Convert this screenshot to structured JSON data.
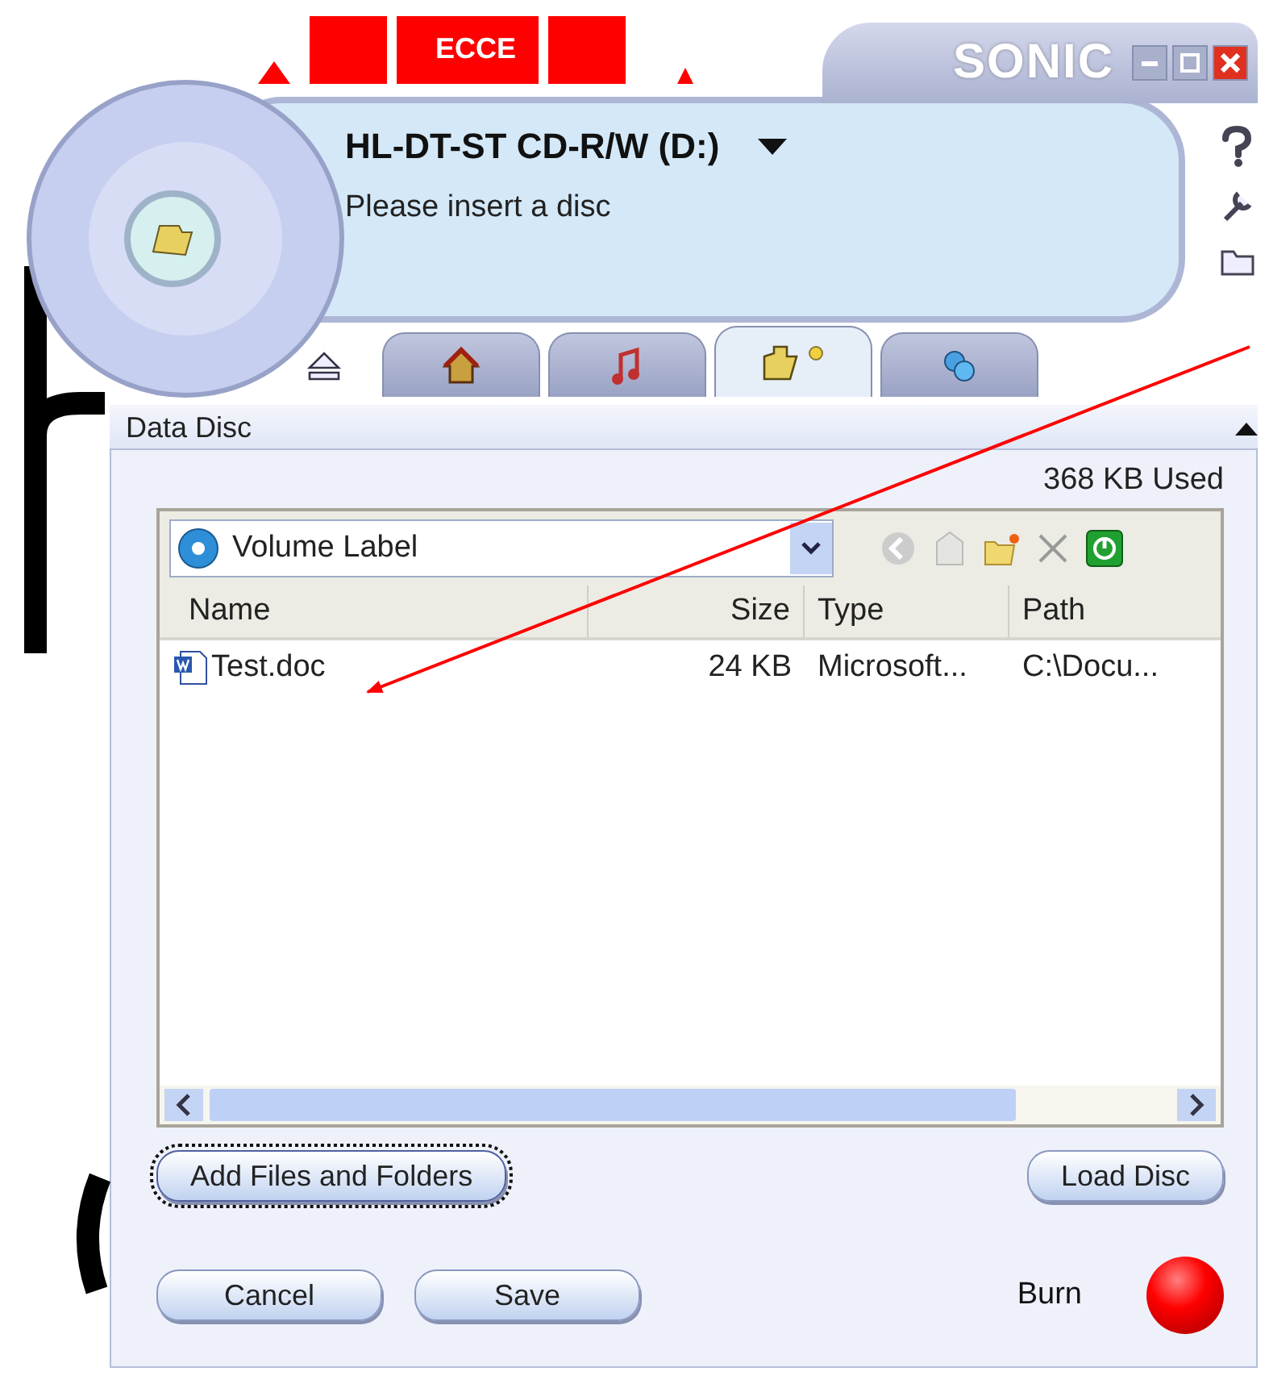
{
  "background_logo": {
    "text": "ECCE"
  },
  "window": {
    "brand": "SONIC",
    "drive": "HL-DT-ST CD-R/W (D:)",
    "status": "Please insert a disc"
  },
  "tabs": [
    {
      "kind": "home",
      "selected": false
    },
    {
      "kind": "music",
      "selected": false
    },
    {
      "kind": "data",
      "selected": true
    },
    {
      "kind": "copy",
      "selected": false
    }
  ],
  "panel": {
    "title": "Data Disc",
    "usage": "368 KB Used",
    "volume_label": "Volume Label",
    "table": {
      "columns": [
        "Name",
        "Size",
        "Type",
        "Path"
      ],
      "rows": [
        [
          "Test.doc",
          "24 KB",
          "Microsoft...",
          "C:\\Docu..."
        ]
      ]
    }
  },
  "buttons": [
    {
      "label": "Add Files and Folders",
      "focused": true
    },
    {
      "label": "Load Disc",
      "focused": false
    },
    {
      "label": "Cancel",
      "focused": false
    },
    {
      "label": "Save",
      "focused": false
    }
  ],
  "burn": {
    "label": "Burn"
  }
}
